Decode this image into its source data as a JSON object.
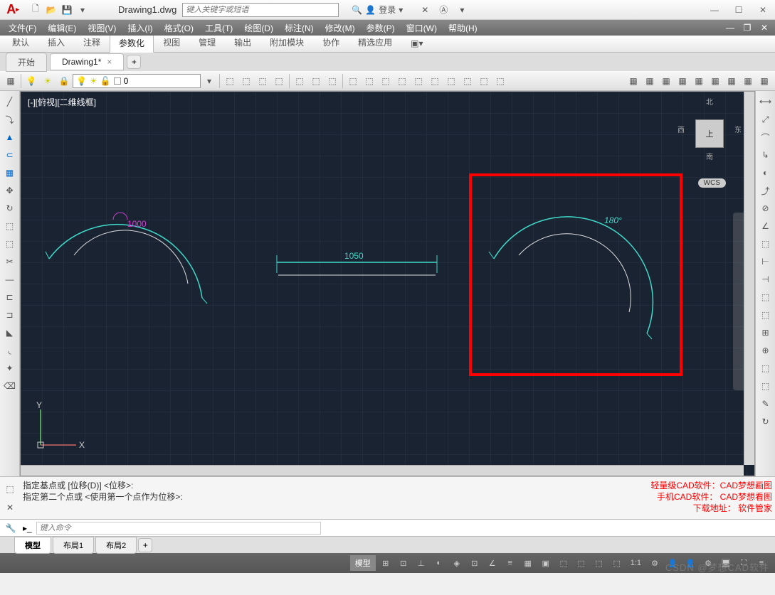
{
  "title": "Drawing1.dwg",
  "search_placeholder": "键入关键字或短语",
  "login": "登录",
  "menu": [
    "文件(F)",
    "编辑(E)",
    "视图(V)",
    "插入(I)",
    "格式(O)",
    "工具(T)",
    "绘图(D)",
    "标注(N)",
    "修改(M)",
    "参数(P)",
    "窗口(W)",
    "帮助(H)"
  ],
  "ribtabs": [
    "默认",
    "插入",
    "注释",
    "参数化",
    "视图",
    "管理",
    "输出",
    "附加模块",
    "协作",
    "精选应用"
  ],
  "ribactive": 3,
  "doctabs": [
    {
      "label": "开始",
      "active": false
    },
    {
      "label": "Drawing1*",
      "active": true
    }
  ],
  "layer_current": "0",
  "canvas_label": "[-][俯视][二维线框]",
  "viewcube": {
    "n": "北",
    "s": "南",
    "e": "东",
    "w": "西",
    "top": "上"
  },
  "wcs": "WCS",
  "dims": {
    "arc1": "1000",
    "linear": "1050",
    "angle": "180°"
  },
  "ucs": {
    "x": "X",
    "y": "Y"
  },
  "cmd_lines": [
    "指定基点或 [位移(D)] <位移>:",
    "指定第二个点或 <使用第一个点作为位移>:"
  ],
  "cmd_placeholder": "键入命令",
  "ads": [
    "轻量级CAD软件：CAD梦想画图",
    "手机CAD软件：  CAD梦想看图",
    "下载地址：    软件管家"
  ],
  "layouts": [
    {
      "label": "模型",
      "active": true
    },
    {
      "label": "布局1",
      "active": false
    },
    {
      "label": "布局2",
      "active": false
    }
  ],
  "status": {
    "model": "模型",
    "scale": "1:1"
  },
  "watermark": "CSDN @梦想CAD软件"
}
